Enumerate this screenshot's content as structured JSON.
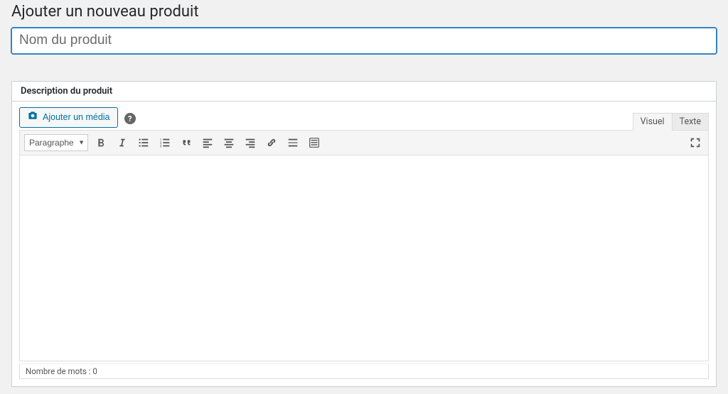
{
  "page": {
    "title": "Ajouter un nouveau produit"
  },
  "titleField": {
    "placeholder": "Nom du produit",
    "value": ""
  },
  "descBox": {
    "heading": "Description du produit"
  },
  "media": {
    "addLabel": "Ajouter un média"
  },
  "editorTabs": {
    "visual": "Visuel",
    "text": "Texte",
    "active": "visual"
  },
  "toolbar": {
    "formatLabel": "Paragraphe"
  },
  "status": {
    "wordCountPrefix": "Nombre de mots : ",
    "wordCount": "0"
  }
}
